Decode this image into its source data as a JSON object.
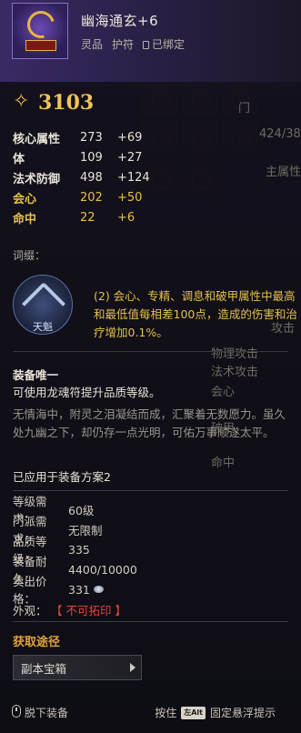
{
  "item": {
    "name": "幽海通玄+6",
    "quality": "灵品",
    "type": "护符",
    "bind": "已绑定",
    "power": "3103"
  },
  "stats": [
    {
      "label": "核心属性",
      "value": "273",
      "add": "+69",
      "highlight": false
    },
    {
      "label": "体",
      "value": "109",
      "add": "+27",
      "highlight": false
    },
    {
      "label": "法术防御",
      "value": "498",
      "add": "+124",
      "highlight": false
    },
    {
      "label": "会心",
      "value": "202",
      "add": "+50",
      "highlight": true
    },
    {
      "label": "命中",
      "value": "22",
      "add": "+6",
      "highlight": true
    }
  ],
  "affix": {
    "title": "词缀：",
    "name": "天魁",
    "description": "(2) 会心、专精、调息和破甲属性中最高和最低值每相差100点，造成的伤害和治疗增加0.1%。"
  },
  "unique": {
    "line1": "装备唯一",
    "line2": "可使用龙魂符提升品质等级。"
  },
  "lore": "无情海中，附灵之泪凝结而成，汇聚着无数愿力。虽久处九幽之下，却仍存一点光明，可佑万事顺遂太平。",
  "applied": "已应用于装备方案2",
  "info": [
    {
      "key": "等级需求：",
      "value": "60级"
    },
    {
      "key": "门派需求：",
      "value": "无限制"
    },
    {
      "key": "品质等级：",
      "value": "335"
    },
    {
      "key": "装备耐久：",
      "value": "4400/10000"
    },
    {
      "key": "卖出价格：",
      "value": "331"
    },
    {
      "key": "外观：",
      "value": "【 不可拓印 】"
    }
  ],
  "source": {
    "title": "获取途径",
    "button": "副本宝箱"
  },
  "footer": {
    "unequip": "脱下装备",
    "press": "按住",
    "key": "左Alt",
    "pin": "固定悬浮提示"
  },
  "background": {
    "labels": [
      "门",
      "424/38",
      "主属性",
      "攻击",
      "物理攻击",
      "法术攻击",
      "会心",
      "破甲",
      "命中"
    ]
  },
  "colors": {
    "gold": "#e5c04d",
    "power": "#f0c25a",
    "red": "#e0493a",
    "source": "#e0a43a"
  }
}
